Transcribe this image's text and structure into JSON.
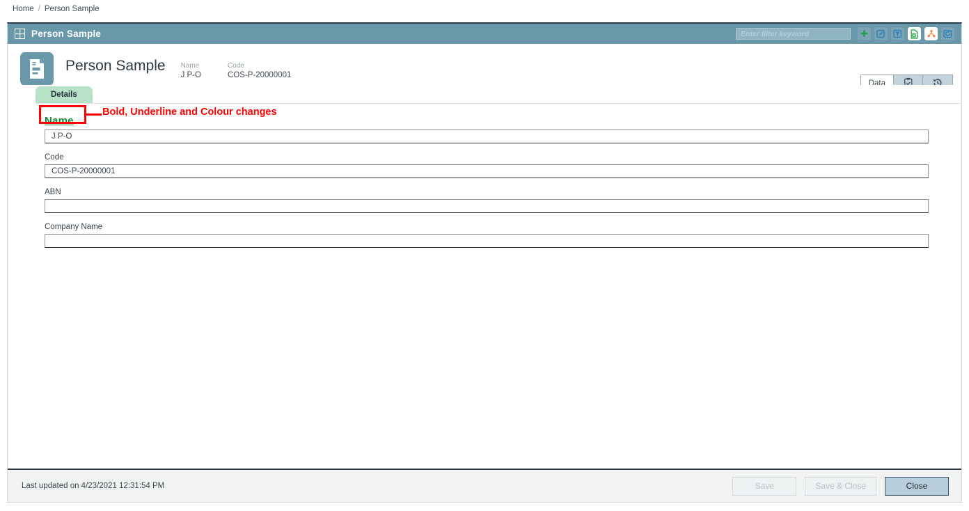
{
  "breadcrumb": {
    "home": "Home",
    "separator": "/",
    "current": "Person Sample"
  },
  "titlebar": {
    "icon": "grid-icon",
    "title": "Person Sample",
    "filter": {
      "value": "",
      "placeholder": "Enter filter keyword"
    },
    "buttons": [
      {
        "name": "add-icon",
        "label": "Add",
        "color": "#1e9e3e"
      },
      {
        "name": "edit-icon",
        "label": "Edit",
        "color": "#2c7fb8"
      },
      {
        "name": "filter-icon",
        "label": "Filter",
        "color": "#2c7fb8"
      },
      {
        "name": "excel-export-icon",
        "label": "Export to Excel",
        "color": "#1e9e3e"
      },
      {
        "name": "workflow-icon",
        "label": "Workflow",
        "color": "#e8803a"
      },
      {
        "name": "refresh-icon",
        "label": "Refresh",
        "color": "#2c7fb8"
      }
    ]
  },
  "record": {
    "icon": "document-icon",
    "title": "Person Sample",
    "meta": [
      {
        "label": "Name",
        "value": "J P-O"
      },
      {
        "label": "Code",
        "value": "COS-P-20000001"
      }
    ]
  },
  "right_tabs": [
    {
      "name": "tab-data",
      "label": "Data",
      "active": true
    },
    {
      "name": "tab-notes",
      "label": "",
      "icon": "clipboard-check-icon",
      "active": false
    },
    {
      "name": "tab-history",
      "label": "",
      "icon": "history-revert-icon",
      "active": false
    }
  ],
  "sub_tabs": [
    {
      "name": "tab-details",
      "label": "Details",
      "active": true
    }
  ],
  "form": {
    "fields": [
      {
        "name": "name-field",
        "label": "Name",
        "value": "J P-O",
        "highlighted": true
      },
      {
        "name": "code-field",
        "label": "Code",
        "value": "COS-P-20000001",
        "highlighted": false
      },
      {
        "name": "abn-field",
        "label": "ABN",
        "value": "",
        "highlighted": false
      },
      {
        "name": "company-name-field",
        "label": "Company Name",
        "value": "",
        "highlighted": false
      }
    ]
  },
  "annotation": {
    "text": "Bold, Underline and Colour changes",
    "color": "#ff0000",
    "target": "Name"
  },
  "footer": {
    "last_updated": "Last updated on 4/23/2021 12:31:54 PM",
    "buttons": [
      {
        "name": "save-button",
        "label": "Save",
        "state": "disabled"
      },
      {
        "name": "save-and-close-button",
        "label": "Save & Close",
        "state": "disabled"
      },
      {
        "name": "close-button",
        "label": "Close",
        "state": "enabled"
      }
    ]
  },
  "colors": {
    "header_teal": "#6998ab",
    "tab_green": "#b7e2c8",
    "label_green": "#1a8a3c",
    "annotation_red": "#ff0000",
    "footer_bg": "#f1f3f3"
  }
}
